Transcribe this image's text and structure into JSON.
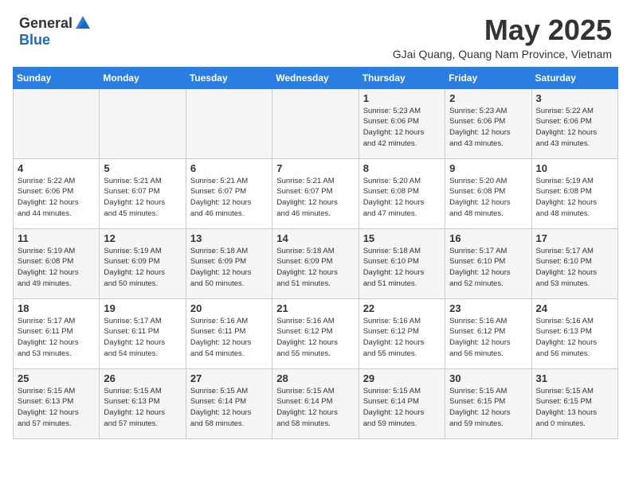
{
  "header": {
    "logo_general": "General",
    "logo_blue": "Blue",
    "month": "May 2025",
    "location": "GJai Quang, Quang Nam Province, Vietnam"
  },
  "days_of_week": [
    "Sunday",
    "Monday",
    "Tuesday",
    "Wednesday",
    "Thursday",
    "Friday",
    "Saturday"
  ],
  "weeks": [
    [
      {
        "day": "",
        "info": ""
      },
      {
        "day": "",
        "info": ""
      },
      {
        "day": "",
        "info": ""
      },
      {
        "day": "",
        "info": ""
      },
      {
        "day": "1",
        "info": "Sunrise: 5:23 AM\nSunset: 6:06 PM\nDaylight: 12 hours\nand 42 minutes."
      },
      {
        "day": "2",
        "info": "Sunrise: 5:23 AM\nSunset: 6:06 PM\nDaylight: 12 hours\nand 43 minutes."
      },
      {
        "day": "3",
        "info": "Sunrise: 5:22 AM\nSunset: 6:06 PM\nDaylight: 12 hours\nand 43 minutes."
      }
    ],
    [
      {
        "day": "4",
        "info": "Sunrise: 5:22 AM\nSunset: 6:06 PM\nDaylight: 12 hours\nand 44 minutes."
      },
      {
        "day": "5",
        "info": "Sunrise: 5:21 AM\nSunset: 6:07 PM\nDaylight: 12 hours\nand 45 minutes."
      },
      {
        "day": "6",
        "info": "Sunrise: 5:21 AM\nSunset: 6:07 PM\nDaylight: 12 hours\nand 46 minutes."
      },
      {
        "day": "7",
        "info": "Sunrise: 5:21 AM\nSunset: 6:07 PM\nDaylight: 12 hours\nand 46 minutes."
      },
      {
        "day": "8",
        "info": "Sunrise: 5:20 AM\nSunset: 6:08 PM\nDaylight: 12 hours\nand 47 minutes."
      },
      {
        "day": "9",
        "info": "Sunrise: 5:20 AM\nSunset: 6:08 PM\nDaylight: 12 hours\nand 48 minutes."
      },
      {
        "day": "10",
        "info": "Sunrise: 5:19 AM\nSunset: 6:08 PM\nDaylight: 12 hours\nand 48 minutes."
      }
    ],
    [
      {
        "day": "11",
        "info": "Sunrise: 5:19 AM\nSunset: 6:08 PM\nDaylight: 12 hours\nand 49 minutes."
      },
      {
        "day": "12",
        "info": "Sunrise: 5:19 AM\nSunset: 6:09 PM\nDaylight: 12 hours\nand 50 minutes."
      },
      {
        "day": "13",
        "info": "Sunrise: 5:18 AM\nSunset: 6:09 PM\nDaylight: 12 hours\nand 50 minutes."
      },
      {
        "day": "14",
        "info": "Sunrise: 5:18 AM\nSunset: 6:09 PM\nDaylight: 12 hours\nand 51 minutes."
      },
      {
        "day": "15",
        "info": "Sunrise: 5:18 AM\nSunset: 6:10 PM\nDaylight: 12 hours\nand 51 minutes."
      },
      {
        "day": "16",
        "info": "Sunrise: 5:17 AM\nSunset: 6:10 PM\nDaylight: 12 hours\nand 52 minutes."
      },
      {
        "day": "17",
        "info": "Sunrise: 5:17 AM\nSunset: 6:10 PM\nDaylight: 12 hours\nand 53 minutes."
      }
    ],
    [
      {
        "day": "18",
        "info": "Sunrise: 5:17 AM\nSunset: 6:11 PM\nDaylight: 12 hours\nand 53 minutes."
      },
      {
        "day": "19",
        "info": "Sunrise: 5:17 AM\nSunset: 6:11 PM\nDaylight: 12 hours\nand 54 minutes."
      },
      {
        "day": "20",
        "info": "Sunrise: 5:16 AM\nSunset: 6:11 PM\nDaylight: 12 hours\nand 54 minutes."
      },
      {
        "day": "21",
        "info": "Sunrise: 5:16 AM\nSunset: 6:12 PM\nDaylight: 12 hours\nand 55 minutes."
      },
      {
        "day": "22",
        "info": "Sunrise: 5:16 AM\nSunset: 6:12 PM\nDaylight: 12 hours\nand 55 minutes."
      },
      {
        "day": "23",
        "info": "Sunrise: 5:16 AM\nSunset: 6:12 PM\nDaylight: 12 hours\nand 56 minutes."
      },
      {
        "day": "24",
        "info": "Sunrise: 5:16 AM\nSunset: 6:13 PM\nDaylight: 12 hours\nand 56 minutes."
      }
    ],
    [
      {
        "day": "25",
        "info": "Sunrise: 5:15 AM\nSunset: 6:13 PM\nDaylight: 12 hours\nand 57 minutes."
      },
      {
        "day": "26",
        "info": "Sunrise: 5:15 AM\nSunset: 6:13 PM\nDaylight: 12 hours\nand 57 minutes."
      },
      {
        "day": "27",
        "info": "Sunrise: 5:15 AM\nSunset: 6:14 PM\nDaylight: 12 hours\nand 58 minutes."
      },
      {
        "day": "28",
        "info": "Sunrise: 5:15 AM\nSunset: 6:14 PM\nDaylight: 12 hours\nand 58 minutes."
      },
      {
        "day": "29",
        "info": "Sunrise: 5:15 AM\nSunset: 6:14 PM\nDaylight: 12 hours\nand 59 minutes."
      },
      {
        "day": "30",
        "info": "Sunrise: 5:15 AM\nSunset: 6:15 PM\nDaylight: 12 hours\nand 59 minutes."
      },
      {
        "day": "31",
        "info": "Sunrise: 5:15 AM\nSunset: 6:15 PM\nDaylight: 13 hours\nand 0 minutes."
      }
    ]
  ]
}
